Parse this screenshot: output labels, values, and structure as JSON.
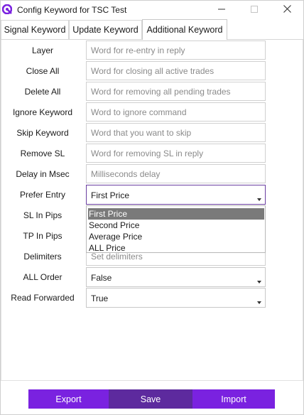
{
  "window": {
    "title": "Config Keyword for TSC Test",
    "icon": "app-logo-icon",
    "controls": [
      "minimize-icon",
      "maximize-icon",
      "close-icon"
    ]
  },
  "tabs": [
    {
      "label": "Signal Keyword"
    },
    {
      "label": "Update Keyword"
    },
    {
      "label": "Additional Keyword",
      "active": true
    }
  ],
  "fields": {
    "layer": {
      "label": "Layer",
      "placeholder": "Word for re-entry in reply"
    },
    "close_all": {
      "label": "Close All",
      "placeholder": "Word for closing all active trades"
    },
    "delete_all": {
      "label": "Delete All",
      "placeholder": "Word for removing all pending trades"
    },
    "ignore_keyword": {
      "label": "Ignore Keyword",
      "placeholder": "Word to ignore command"
    },
    "skip_keyword": {
      "label": "Skip Keyword",
      "placeholder": "Word that you want to skip"
    },
    "remove_sl": {
      "label": "Remove SL",
      "placeholder": "Word for removing SL in reply"
    },
    "delay": {
      "label": "Delay in Msec",
      "placeholder": "Milliseconds delay"
    },
    "prefer_entry": {
      "label": "Prefer Entry",
      "value": "First Price",
      "options": [
        "First Price",
        "Second Price",
        "Average Price",
        "ALL Price"
      ],
      "highlighted": "First Price"
    },
    "sl_in_pips": {
      "label": "SL In Pips"
    },
    "tp_in_pips": {
      "label": "TP In Pips"
    },
    "delimiters": {
      "label": "Delimiters",
      "placeholder": "Set delimiters"
    },
    "all_order": {
      "label": "ALL Order",
      "value": "False"
    },
    "read_forwarded": {
      "label": "Read Forwarded",
      "value": "True"
    }
  },
  "buttons": {
    "export": "Export",
    "save": "Save",
    "import": "Import"
  },
  "colors": {
    "accent": "#7a22e0",
    "save_button": "#5d2a9e",
    "focus_border": "#6a3ea0"
  }
}
